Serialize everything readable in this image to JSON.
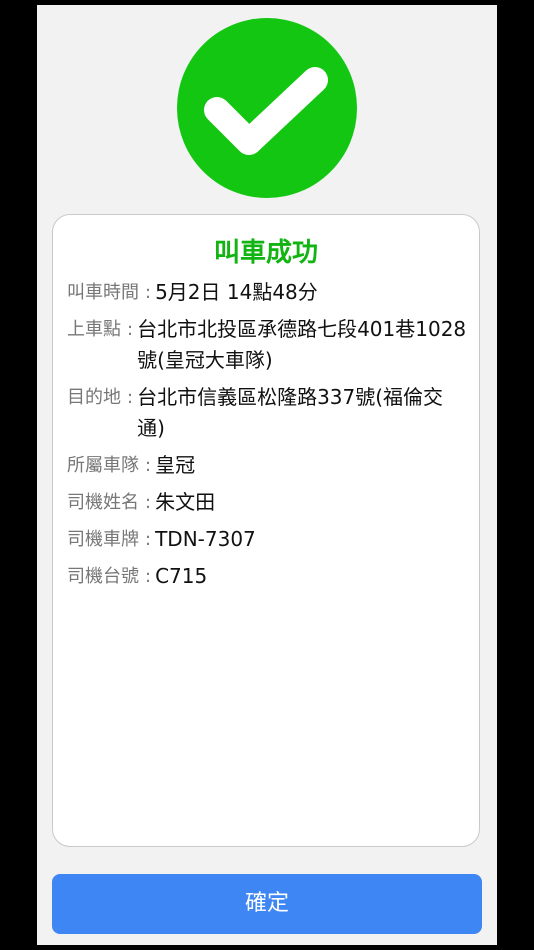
{
  "status_icon": "checkmark-icon",
  "colors": {
    "success": "#12c612",
    "title": "#12b412",
    "button": "#3d86f4"
  },
  "card": {
    "title": "叫車成功",
    "colon": ":",
    "rows": [
      {
        "label": "叫車時間",
        "value": "5月2日 14點48分"
      },
      {
        "label": "上車點",
        "value": "台北市北投區承德路七段401巷1028號(皇冠大車隊)"
      },
      {
        "label": "目的地",
        "value": "台北市信義區松隆路337號(福倫交通)"
      },
      {
        "label": "所屬車隊",
        "value": "皇冠"
      },
      {
        "label": "司機姓名",
        "value": "朱文田"
      },
      {
        "label": "司機車牌",
        "value": "TDN-7307"
      },
      {
        "label": "司機台號",
        "value": "C715"
      }
    ]
  },
  "confirm_button": {
    "label": "確定"
  }
}
